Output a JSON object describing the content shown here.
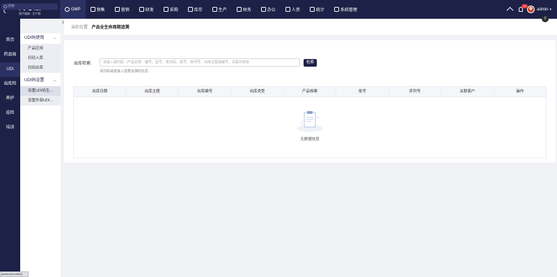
{
  "brand": {
    "name": "同心雁",
    "subtitle": "医疗器械 · 生产版"
  },
  "topnav": [
    {
      "label": "GMP",
      "icon": "gmp-icon",
      "active": true
    },
    {
      "label": "销售",
      "icon": "chart-icon"
    },
    {
      "label": "营销",
      "icon": "bar-chart-icon"
    },
    {
      "label": "研发",
      "icon": "flask-icon"
    },
    {
      "label": "采购",
      "icon": "cart-icon"
    },
    {
      "label": "库存",
      "icon": "warehouse-icon"
    },
    {
      "label": "生产",
      "icon": "factory-icon"
    },
    {
      "label": "财务",
      "icon": "money-icon"
    },
    {
      "label": "办公",
      "icon": "briefcase-icon"
    },
    {
      "label": "人资",
      "icon": "person-icon"
    },
    {
      "label": "统计",
      "icon": "pie-icon"
    },
    {
      "label": "系统管理",
      "icon": "settings-icon"
    }
  ],
  "top_right": {
    "badge": "14",
    "user": "admin"
  },
  "sidebar": {
    "search_placeholder": "搜索",
    "items": [
      {
        "label": "首页"
      },
      {
        "label": "药品局"
      },
      {
        "label": "UDI",
        "active": true
      },
      {
        "label": "出库检"
      },
      {
        "label": "养护"
      },
      {
        "label": "巡检"
      },
      {
        "label": "培训"
      }
    ]
  },
  "subnav": {
    "groups": [
      {
        "label": "UDI码使用",
        "items": [
          "产品应用",
          "扫码入库",
          "扫码出库"
        ]
      },
      {
        "label": "UDI码设置",
        "items": [
          "设置UDI码生...",
          "设置外部UDI..."
        ]
      }
    ]
  },
  "tooltip": "javascript:void(0)",
  "breadcrumb": {
    "prefix": "当前位置:",
    "current": "产品全生命周期追溯"
  },
  "search": {
    "label": "出库检索:",
    "placeholder": "请输入或扫码（产品名称、编号、型号、条形码、批号、序列号、出库主题或编号、关联外部单",
    "button": "检索",
    "hint": "请扫码或者输入需要追溯的信息"
  },
  "table": {
    "columns": [
      "出库日期",
      "出库主题",
      "出库编号",
      "出库类型",
      "产品档案",
      "批号",
      "序列号",
      "关联客户",
      "操作"
    ],
    "rows": [],
    "empty_text": "无数据信息"
  },
  "colors": {
    "nav_bg": "#1d2147",
    "page_bg": "#f0f2f5",
    "accent": "#1d2147"
  }
}
